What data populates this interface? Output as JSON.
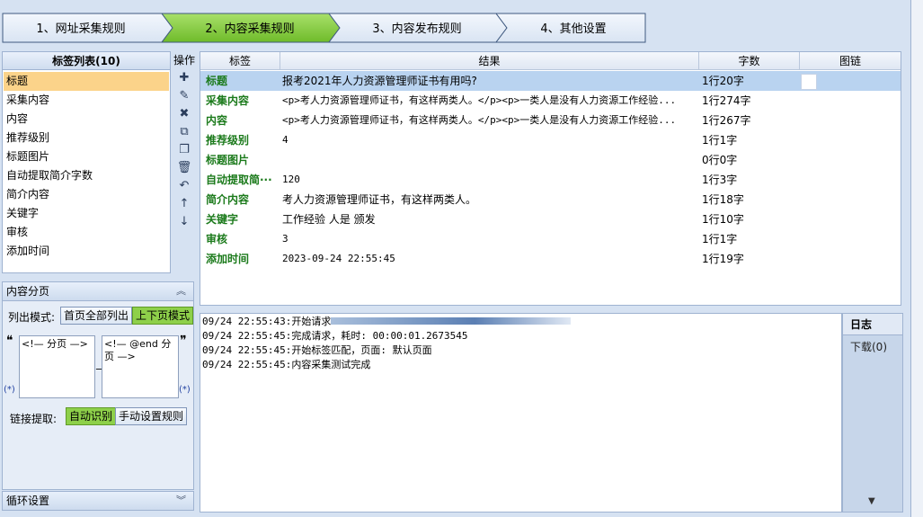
{
  "steps": [
    "1、网址采集规则",
    "2、内容采集规则",
    "3、内容发布规则",
    "4、其他设置"
  ],
  "active_step": 1,
  "tag_list": {
    "title": "标签列表(10)",
    "items": [
      "标题",
      "采集内容",
      "内容",
      "推荐级别",
      "标题图片",
      "自动提取简介字数",
      "简介内容",
      "关键字",
      "审核",
      "添加时间"
    ],
    "selected_index": 0
  },
  "ops": {
    "title": "操作",
    "icons": [
      {
        "name": "add-icon",
        "glyph": "✚"
      },
      {
        "name": "edit-icon",
        "glyph": "✎"
      },
      {
        "name": "delete-icon",
        "glyph": "✖"
      },
      {
        "name": "copy-icon",
        "glyph": "⧉"
      },
      {
        "name": "paste-icon",
        "glyph": "❐"
      },
      {
        "name": "trash-icon",
        "glyph": "🗑"
      },
      {
        "name": "undo-icon",
        "glyph": "↶"
      },
      {
        "name": "move-up-icon",
        "glyph": "↑"
      },
      {
        "name": "move-down-icon",
        "glyph": "↓"
      }
    ]
  },
  "pagination": {
    "title": "内容分页",
    "list_mode_label": "列出模式:",
    "mode_all": "首页全部列出",
    "mode_updown": "上下页模式",
    "start_marker": "<!— 分页 —>",
    "end_marker": "<!— @end 分页 —>",
    "quote_open": "❝",
    "quote_close": "❞",
    "star": "(*)",
    "dash": "_",
    "link_extract_label": "链接提取:",
    "auto_detect": "自动识别",
    "manual_rule": "手动设置规则"
  },
  "loop_settings": {
    "title": "循环设置"
  },
  "results": {
    "columns": [
      "标签",
      "结果",
      "字数",
      "图链"
    ],
    "rows": [
      {
        "name": "标题",
        "result": "报考2021年人力资源管理师证书有用吗?",
        "count": "1行20字"
      },
      {
        "name": "采集内容",
        "result": "<p>考人力资源管理师证书，有这样两类人。</p><p>一类人是没有人力资源工作经验...",
        "count": "1行274字"
      },
      {
        "name": "内容",
        "result": "<p>考人力资源管理师证书，有这样两类人。</p><p>一类人是没有人力资源工作经验...",
        "count": "1行267字"
      },
      {
        "name": "推荐级别",
        "result": "4",
        "count": "1行1字"
      },
      {
        "name": "标题图片",
        "result": "",
        "count": "0行0字"
      },
      {
        "name": "自动提取简···",
        "result": "120",
        "count": "1行3字"
      },
      {
        "name": "简介内容",
        "result": "考人力资源管理师证书，有这样两类人。",
        "count": "1行18字"
      },
      {
        "name": "关键字",
        "result": "工作经验 人是 颁发",
        "count": "1行10字"
      },
      {
        "name": "审核",
        "result": "3",
        "count": "1行1字"
      },
      {
        "name": "添加时间",
        "result": "2023-09-24 22:55:45",
        "count": "1行19字"
      }
    ],
    "selected_index": 0
  },
  "log": {
    "lines": [
      "09/24 22:55:43:开始请求",
      "09/24 22:55:45:完成请求，耗时: 00:00:01.2673545",
      "09/24 22:55:45:开始标签匹配，页面: 默认页面",
      "09/24 22:55:45:内容采集测试完成"
    ]
  },
  "side_tabs": {
    "log": "日志",
    "download": "下载(0)"
  },
  "colors": {
    "active_step": "#8ed04a",
    "selected_tag": "#fbd38a",
    "tag_name": "#1b7a1b"
  }
}
